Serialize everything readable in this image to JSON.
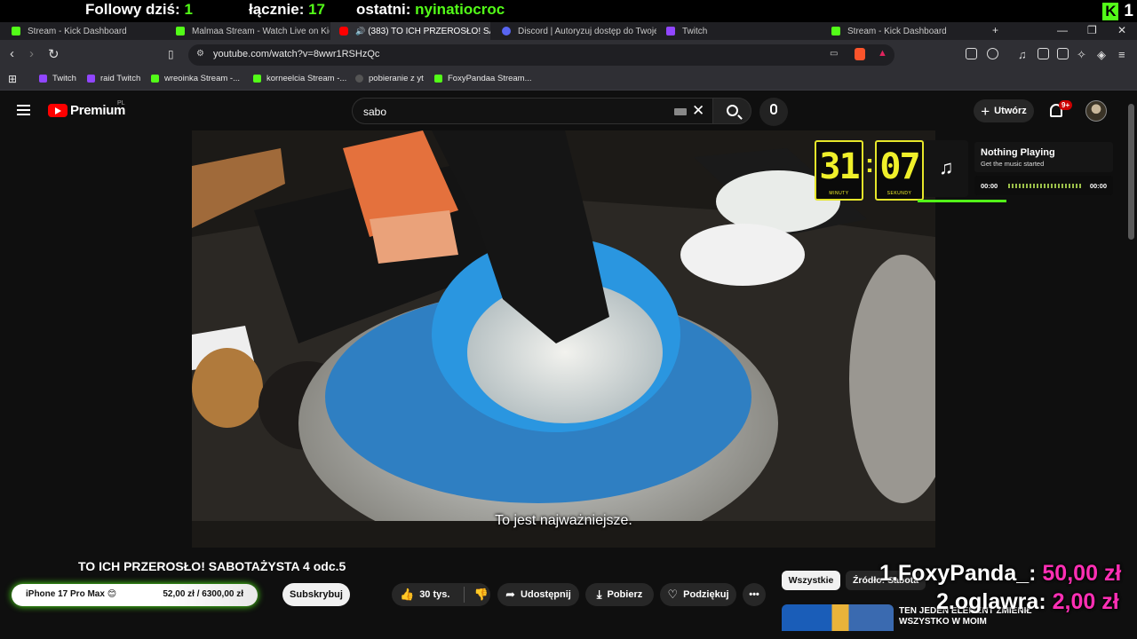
{
  "stream_overlay": {
    "followers_today_label": "Followy dziś:",
    "followers_today_value": "1",
    "total_label": "łącznie:",
    "total_value": "17",
    "last_label": "ostatni:",
    "last_value": "nyinatiocroc",
    "kick_count": "1",
    "leaderboard": [
      {
        "name": "1.FoxyPanda_:",
        "amount": "50,00 zł"
      },
      {
        "name": "2.oglawra:",
        "amount": "2,00 zł"
      }
    ],
    "donation_goal": {
      "name": "iPhone 17 Pro Max 😊",
      "amount": "52,00 zł  /  6300,00 zł",
      "progress_fraction": 0.0083
    }
  },
  "browser": {
    "tabs": [
      {
        "label": "Stream - Kick Dashboard",
        "icon": "kick-icon",
        "active": false
      },
      {
        "label": "Malmaa Stream - Watch Live on Kick",
        "icon": "kick-icon",
        "active": false
      },
      {
        "label": "(383) TO ICH PRZEROSŁO! SA",
        "icon": "youtube-icon",
        "active": true
      },
      {
        "label": "Discord | Autoryzuj dostęp do Twojego",
        "icon": "discord-icon",
        "active": false
      },
      {
        "label": "Twitch",
        "icon": "twitch-icon",
        "active": false
      },
      {
        "label": "Stream - Kick Dashboard",
        "icon": "kick-icon",
        "active": false
      }
    ],
    "url": "youtube.com/watch?v=8wwr1RSHzQc",
    "bookmarks": [
      {
        "label": "Twitch",
        "icon": "twitch-icon"
      },
      {
        "label": "raid Twitch",
        "icon": "twitch-icon"
      },
      {
        "label": "wreoinka Stream -...",
        "icon": "kick-icon"
      },
      {
        "label": "korneelcia Stream -...",
        "icon": "kick-icon"
      },
      {
        "label": "pobieranie z yt",
        "icon": "globe-icon"
      },
      {
        "label": "FoxyPandaa Stream...",
        "icon": "kick-icon"
      }
    ]
  },
  "youtube": {
    "logo_text": "Premium",
    "country": "PL",
    "search_value": "sabo",
    "create_label": "Utwórz",
    "notifications_badge": "9+",
    "video": {
      "subtitle": "To jest najważniejsze.",
      "title": "TO ICH PRZEROSŁO! SABOTAŻYSTA 4 odc.5"
    },
    "actions": {
      "subscribe": "Subskrybuj",
      "likes": "30 tys.",
      "share": "Udostępnij",
      "download": "Pobierz",
      "thanks": "Podziękuj"
    },
    "chips": [
      "Wszystkie",
      "Źródło: Sabota"
    ],
    "recommended_title": "TEN JEDEN ELEMENT ZMIENIŁ WSZYSTKO W MOIM"
  },
  "timer": {
    "minutes": "31",
    "minutes_label": "MINUTY",
    "seconds": "07",
    "seconds_label": "SEKUNDY"
  },
  "music_widget": {
    "title": "Nothing Playing",
    "subtitle": "Get the music started",
    "time_start": "00:00",
    "time_end": "00:00"
  },
  "colors": {
    "kick_green": "#53fc18",
    "timer_yellow": "#f0f02a",
    "leaderboard_amount": "#ff2fb4",
    "youtube_red": "#ff0000"
  }
}
